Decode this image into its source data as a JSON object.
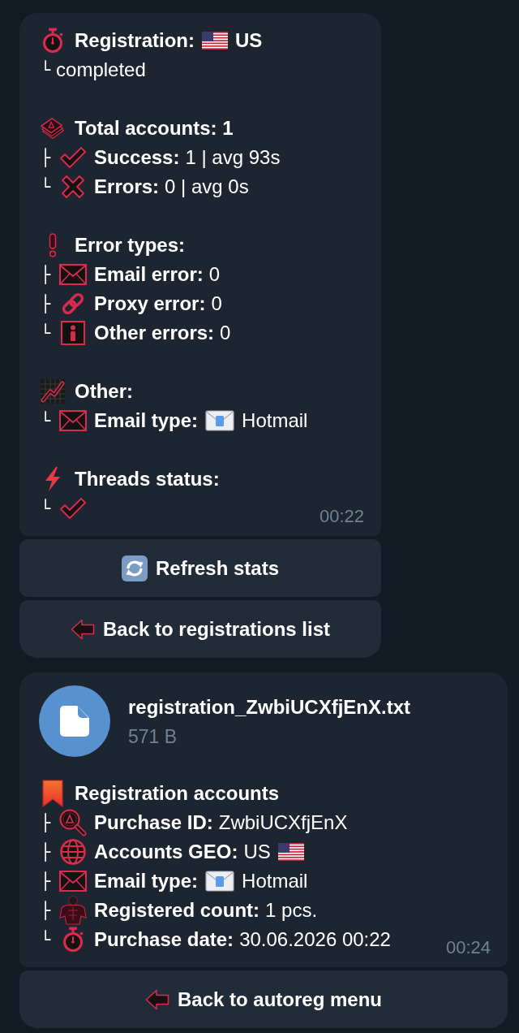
{
  "messages": [
    {
      "sections": [
        {
          "header": {
            "title": "Registration:",
            "value": "US"
          },
          "items": [
            {
              "branch": "└",
              "value": "completed"
            }
          ]
        },
        {
          "header": {
            "title": "Total accounts: 1"
          },
          "items": [
            {
              "branch": "├",
              "label": "Success:",
              "value": "1 | avg 93s"
            },
            {
              "branch": "└",
              "label": "Errors:",
              "value": "0 | avg 0s"
            }
          ]
        },
        {
          "header": {
            "title": "Error types:"
          },
          "items": [
            {
              "branch": "├",
              "label": "Email error:",
              "value": "0"
            },
            {
              "branch": "├",
              "label": "Proxy error:",
              "value": "0"
            },
            {
              "branch": "└",
              "label": "Other errors:",
              "value": "0"
            }
          ]
        },
        {
          "header": {
            "title": "Other:"
          },
          "items": [
            {
              "branch": "└",
              "label": "Email type:",
              "value": "Hotmail"
            }
          ]
        },
        {
          "header": {
            "title": "Threads status:"
          },
          "items": [
            {
              "branch": "└"
            }
          ]
        }
      ],
      "time": "00:22",
      "buttons": [
        {
          "label": "Refresh stats"
        },
        {
          "label": "Back to registrations list"
        }
      ]
    },
    {
      "file": {
        "name": "registration_ZwbiUCXfjEnX.txt",
        "size": "571 B"
      },
      "sections": [
        {
          "header": {
            "title": "Registration accounts"
          },
          "items": [
            {
              "branch": "├",
              "label": "Purchase ID:",
              "value": "ZwbiUCXfjEnX"
            },
            {
              "branch": "├",
              "label": "Accounts GEO:",
              "value": "US"
            },
            {
              "branch": "├",
              "label": "Email type:",
              "value": "Hotmail"
            },
            {
              "branch": "├",
              "label": "Registered count:",
              "value": "1 pcs."
            },
            {
              "branch": "└",
              "label": "Purchase date:",
              "value": "30.06.2026 00:22"
            }
          ]
        }
      ],
      "time": "00:24",
      "buttons": [
        {
          "label": "Back to autoreg menu"
        }
      ]
    }
  ]
}
